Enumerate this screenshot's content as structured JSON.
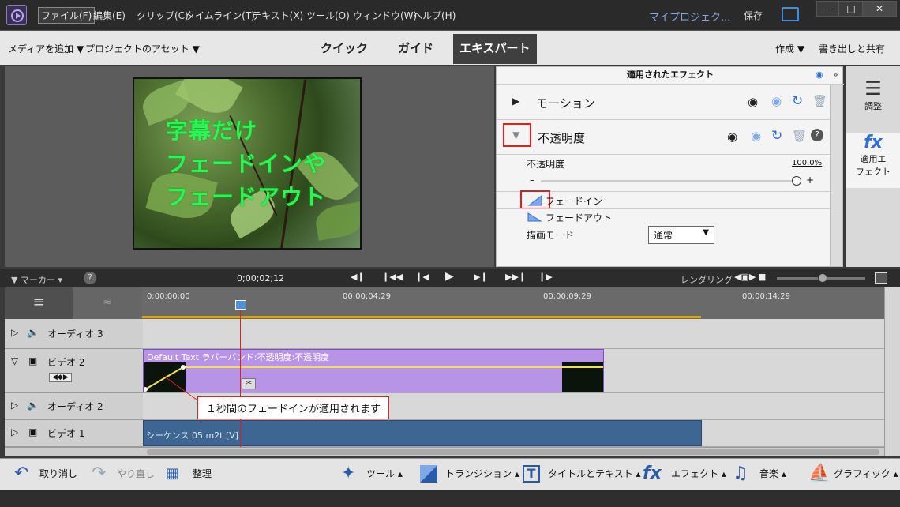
{
  "menu": {
    "items": [
      "ファイル(F)",
      "編集(E)",
      "クリップ(C)",
      "タイムライン(T)",
      "テキスト(X)",
      "ツール(O)",
      "ウィンドウ(W)",
      "ヘルプ(H)"
    ],
    "project": "マイプロジェク...",
    "save": "保存"
  },
  "modebar": {
    "add_media": "メディアを追加",
    "project_assets": "プロジェクトのアセット",
    "tabs": [
      "クイック",
      "ガイド",
      "エキスパート"
    ],
    "selected_tab": "エキスパート",
    "create": "作成",
    "export_share": "書き出しと共有"
  },
  "monitor": {
    "overlay_lines": [
      "字幕だけ",
      "フェードインや",
      "フェードアウト"
    ]
  },
  "effects_panel": {
    "title": "適用されたエフェクト",
    "motion_label": "モーション",
    "opacity_label": "不透明度",
    "opacity_param_label": "不透明度",
    "opacity_value": "100.0",
    "opacity_unit": "%",
    "opacity_level": 1.0,
    "fade_in": "フェードイン",
    "fade_out": "フェードアウト",
    "blend_mode_label": "描画モード",
    "blend_mode_value": "通常"
  },
  "side_panel": {
    "adjust": "調整",
    "applied_effects_line1": "適用エ",
    "applied_effects_line2": "フェクト"
  },
  "timeline_bar": {
    "marker": "マーカー",
    "timecode": "0;00;02;12",
    "rendering": "レンダリング"
  },
  "ruler": {
    "labels": [
      "0;00;00;00",
      "00;00;04;29",
      "00;00;09;29",
      "00;00;14;29"
    ]
  },
  "tracks": {
    "audio3": "オーディオ 3",
    "video2": "ビデオ 2",
    "audio2": "オーディオ 2",
    "video1": "ビデオ 1"
  },
  "clips": {
    "video2_clip": "Default Text ラバーバンド:不透明度:不透明度",
    "video1_clip": "シーケンス 05.m2t [V]"
  },
  "callout": "１秒間のフェードインが適用されます",
  "bottom_bar": {
    "undo": "取り消し",
    "redo": "やり直し",
    "organize": "整理",
    "tools": "ツール",
    "transition": "トランジション",
    "title_text": "タイトルとテキスト",
    "effects": "エフェクト",
    "music": "音楽",
    "graphics": "グラフィック"
  },
  "colors": {
    "accent": "#2f6fd6",
    "highlight_red": "#e02020",
    "clip_purple": "#b894e6",
    "clip_blue": "#3e6692",
    "overlay_text": "#2df25a"
  }
}
